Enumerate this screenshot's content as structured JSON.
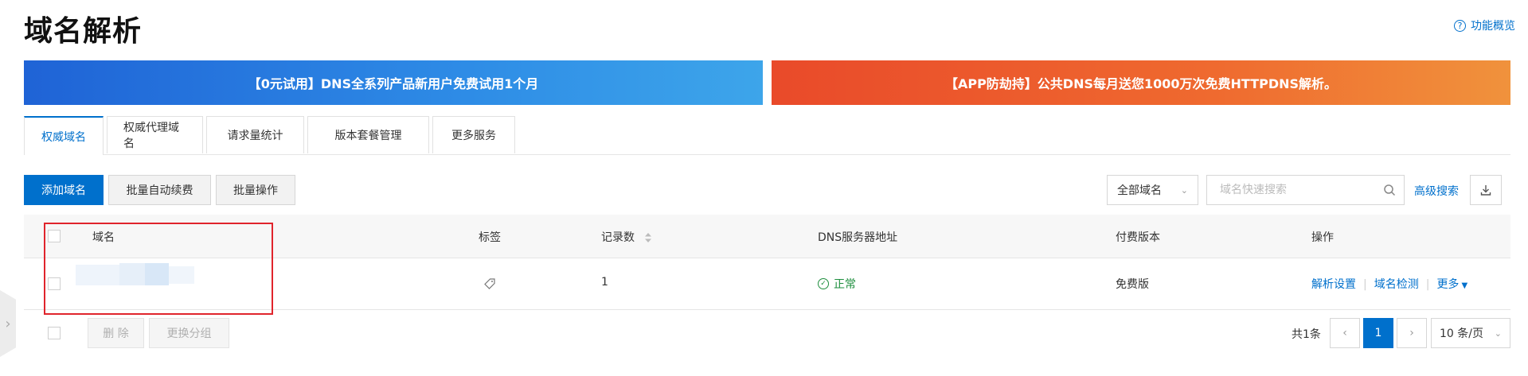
{
  "page": {
    "title": "域名解析",
    "overview_link": "功能概览",
    "overview_icon": "?"
  },
  "banners": {
    "left": "【0元试用】DNS全系列产品新用户免费试用1个月",
    "right": "【APP防劫持】公共DNS每月送您1000万次免费HTTPDNS解析。"
  },
  "tabs": [
    {
      "label": "权威域名",
      "active": true
    },
    {
      "label": "权威代理域名",
      "active": false
    },
    {
      "label": "请求量统计",
      "active": false
    },
    {
      "label": "版本套餐管理",
      "active": false
    },
    {
      "label": "更多服务",
      "active": false
    }
  ],
  "toolbar": {
    "add_domain": "添加域名",
    "batch_renew": "批量自动续费",
    "batch_ops": "批量操作",
    "filter_selected": "全部域名",
    "search_placeholder": "域名快速搜索",
    "advanced_search": "高级搜索"
  },
  "table": {
    "headers": {
      "domain": "域名",
      "tags": "标签",
      "records": "记录数",
      "dns_server": "DNS服务器地址",
      "edition": "付费版本",
      "actions": "操作"
    },
    "rows": [
      {
        "records": "1",
        "dns_status": "正常",
        "edition": "免费版",
        "actions": [
          "解析设置",
          "域名检测",
          "更多"
        ]
      }
    ]
  },
  "bulk": {
    "delete": "删 除",
    "change_group": "更换分组"
  },
  "pagination": {
    "total": "共1条",
    "current_page": "1",
    "page_size": "10 条/页"
  },
  "colors": {
    "primary": "#0070cc",
    "status_ok": "#1e8e3e",
    "highlight_border": "#e0242c"
  },
  "icons": {
    "help": "help-circle-icon",
    "search": "search-icon",
    "download": "download-icon",
    "tag": "tag-icon",
    "sort": "sort-icon",
    "status": "check-circle-icon",
    "side_toggle": "chevron-right-icon"
  }
}
